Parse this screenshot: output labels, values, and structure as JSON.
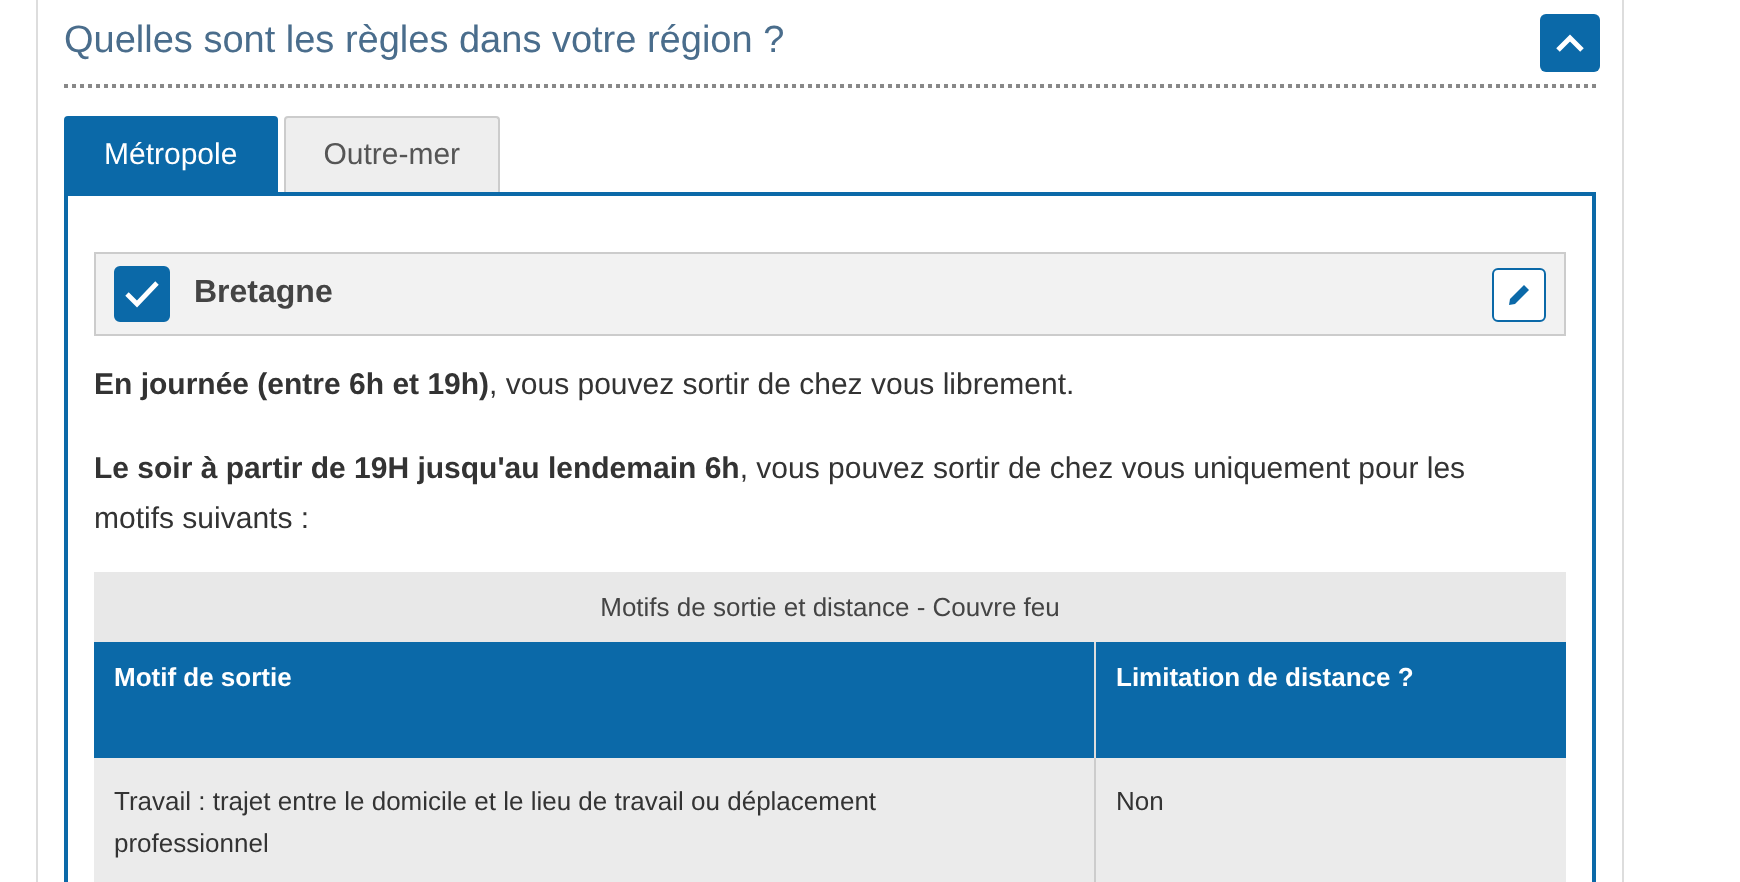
{
  "section": {
    "title": "Quelles sont les règles dans votre région ?",
    "expanded": true
  },
  "tabs": [
    {
      "label": "Métropole",
      "selected": true
    },
    {
      "label": "Outre-mer",
      "selected": false
    }
  ],
  "region": {
    "name": "Bretagne",
    "checked": true
  },
  "paragraphs": [
    "**En journée (entre 6h et 19h)**, vous pouvez sortir de chez vous librement.",
    "**Le soir à partir de 19H jusqu'au lendemain 6h**, vous pouvez sortir de chez vous uniquement pour les motifs suivants :"
  ],
  "table": {
    "caption": "Motifs de sortie et distance - Couvre feu",
    "columns": [
      "Motif de sortie",
      "Limitation de distance ?"
    ],
    "rows": [
      [
        "Travail : trajet entre le domicile et le lieu de travail ou déplacement professionnel",
        "Non"
      ]
    ]
  }
}
